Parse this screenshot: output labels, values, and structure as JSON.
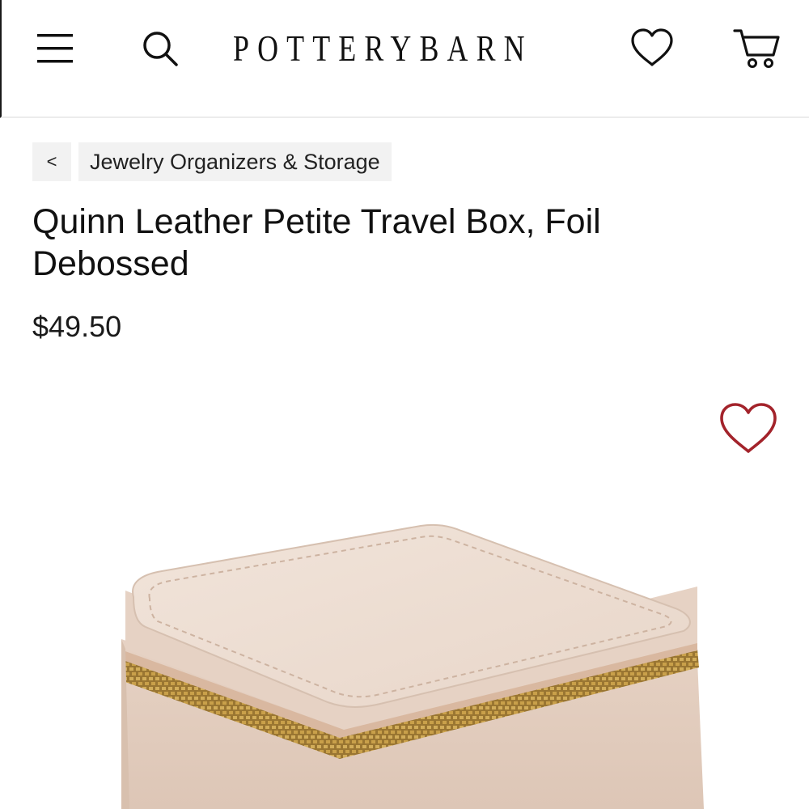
{
  "header": {
    "logo": "POTTERYBARN",
    "icons": {
      "menu": "menu-icon",
      "search": "search-icon",
      "wishlist": "heart-icon",
      "cart": "cart-icon"
    }
  },
  "breadcrumb": {
    "back_label": "<",
    "category": "Jewelry Organizers & Storage"
  },
  "product": {
    "title": "Quinn Leather Petite Travel Box, Foil Debossed",
    "price": "$49.50",
    "favorite_icon": "heart-outline-icon",
    "image_alt": "leather-travel-box-image"
  },
  "colors": {
    "wishlist_heart": "#a3232b",
    "leather": "#ecdcd0",
    "zipper": "#b8923f"
  }
}
